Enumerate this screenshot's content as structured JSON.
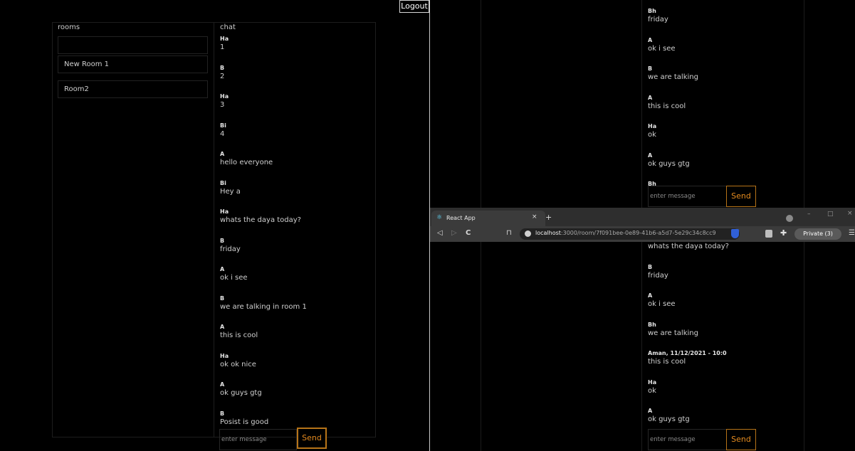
{
  "left_window": {
    "logout_label": "Logout",
    "rooms_title": "rooms",
    "rooms": [
      "",
      "New Room 1",
      "Room2"
    ],
    "chat_title": "chat",
    "messages": [
      {
        "sender": "Ha",
        "text": "1"
      },
      {
        "sender": "B",
        "text": "2"
      },
      {
        "sender": "Ha",
        "text": "3"
      },
      {
        "sender": "Bi",
        "text": "4"
      },
      {
        "sender": "A",
        "text": "hello everyone"
      },
      {
        "sender": "Bi",
        "text": "Hey a"
      },
      {
        "sender": "Ha",
        "text": "whats the daya today?"
      },
      {
        "sender": "B",
        "text": "friday"
      },
      {
        "sender": "A",
        "text": "ok i see"
      },
      {
        "sender": "B",
        "text": "we are talking in room 1"
      },
      {
        "sender": "A",
        "text": "this is cool"
      },
      {
        "sender": "Ha",
        "text": "ok ok nice"
      },
      {
        "sender": "A",
        "text": "ok guys gtg"
      },
      {
        "sender": "B",
        "text": "Posist is good"
      }
    ],
    "input_placeholder": "enter message",
    "send_label": "Send"
  },
  "right_top": {
    "messages": [
      {
        "sender": "Bh",
        "text": "friday"
      },
      {
        "sender": "A",
        "text": "ok i see"
      },
      {
        "sender": "B",
        "text": "we are talking"
      },
      {
        "sender": "A",
        "text": "this is cool"
      },
      {
        "sender": "Ha",
        "text": "ok"
      },
      {
        "sender": "A",
        "text": "ok guys gtg"
      },
      {
        "sender": "Bh",
        "text": ""
      }
    ],
    "input_placeholder": "enter message",
    "send_label": "Send"
  },
  "browser": {
    "tab_title": "React App",
    "tab_close": "×",
    "new_tab": "+",
    "url_host": "localhost",
    "url_rest": ":3000/room/7f091bee-0e89-41b6-a5d7-5e29c34c8cc9",
    "private_label": "Private (3)",
    "controls": {
      "minimize": "–",
      "maximize": "□",
      "close": "×"
    },
    "nav": {
      "back": "◁",
      "forward": "▷",
      "reload": "C",
      "bookmark": "⊓",
      "menu": "☰"
    }
  },
  "right_bottom": {
    "messages": [
      {
        "sender": "",
        "text": "whats the daya today?"
      },
      {
        "sender": "B",
        "text": "friday"
      },
      {
        "sender": "A",
        "text": "ok i see"
      },
      {
        "sender": "Bh",
        "text": "we are talking"
      },
      {
        "sender": "Aman, 11/12/2021 - 10:0",
        "text": "this is cool"
      },
      {
        "sender": "Ha",
        "text": "ok"
      },
      {
        "sender": "A",
        "text": "ok guys gtg"
      }
    ],
    "input_placeholder": "enter message",
    "send_label": "Send"
  },
  "colors": {
    "accent": "#e58b1f",
    "background": "#000000",
    "browser_chrome": "#3b3b3b"
  }
}
